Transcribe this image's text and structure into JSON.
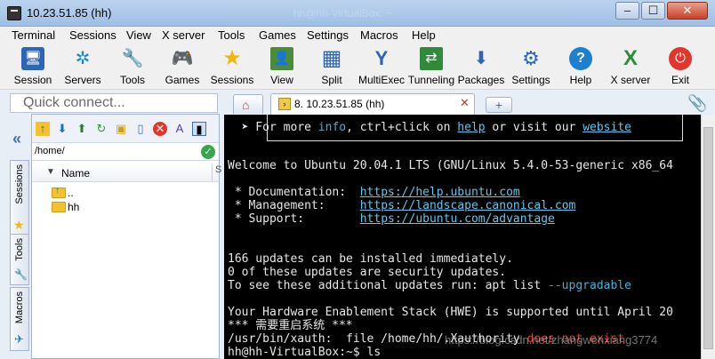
{
  "window": {
    "title": "10.23.51.85 (hh)",
    "ghost_title": "hh@hh-VirtualBox: ~",
    "min_label": "–",
    "max_label": "☐",
    "close_label": "✕"
  },
  "menu": [
    "Terminal",
    "Sessions",
    "View",
    "X server",
    "Tools",
    "Games",
    "Settings",
    "Macros",
    "Help"
  ],
  "toolbar": [
    {
      "label": "Session",
      "icon": "session-icon",
      "glyph": "🖥"
    },
    {
      "label": "Servers",
      "icon": "servers-icon",
      "glyph": "✲"
    },
    {
      "label": "Tools",
      "icon": "tools-icon",
      "glyph": "🔧"
    },
    {
      "label": "Games",
      "icon": "games-icon",
      "glyph": "🎮"
    },
    {
      "label": "Sessions",
      "icon": "star-icon",
      "glyph": "★"
    },
    {
      "label": "View",
      "icon": "view-icon",
      "glyph": "👤"
    },
    {
      "label": "Split",
      "icon": "split-icon",
      "glyph": "▦"
    },
    {
      "label": "MultiExec",
      "icon": "multiexec-icon",
      "glyph": "Y"
    },
    {
      "label": "Tunneling",
      "icon": "tunneling-icon",
      "glyph": "⇄"
    },
    {
      "label": "Packages",
      "icon": "packages-icon",
      "glyph": "⬇"
    },
    {
      "label": "Settings",
      "icon": "gear-icon",
      "glyph": "⚙"
    },
    {
      "label": "Help",
      "icon": "help-icon",
      "glyph": "?"
    },
    {
      "label": "X server",
      "icon": "xserver-icon",
      "glyph": "X"
    },
    {
      "label": "Exit",
      "icon": "power-icon",
      "glyph": "⏻"
    }
  ],
  "quick_connect": {
    "placeholder": "Quick connect..."
  },
  "tabs": {
    "session_tab_label": "8. 10.23.51.85 (hh)",
    "close_label": "✕",
    "new_tab_label": "+"
  },
  "side_tabs": [
    "Sessions",
    "Tools",
    "Macros"
  ],
  "sftp": {
    "path": "/home/",
    "column_name": "Name",
    "column_size_abbr": "S",
    "files": [
      {
        "name": ".."
      },
      {
        "name": "hh"
      }
    ]
  },
  "terminal": {
    "lines": [
      {
        "text": "  ➤ For more ",
        "parts": [
          {
            "t": "info",
            "c": "cy"
          },
          {
            "t": ", ctrl+click on ",
            "c": ""
          },
          {
            "t": "help",
            "c": "ul"
          },
          {
            "t": " or visit our ",
            "c": ""
          },
          {
            "t": "website",
            "c": "ul"
          }
        ]
      },
      {
        "text": ""
      },
      {
        "text": ""
      },
      {
        "text": "Welcome to Ubuntu 20.04.1 LTS (GNU/Linux 5.4.0-53-generic x86_64"
      },
      {
        "text": ""
      },
      {
        "text": " * Documentation:  ",
        "parts": [
          {
            "t": "https://help.ubuntu.com",
            "c": "ul"
          }
        ]
      },
      {
        "text": " * Management:     ",
        "parts": [
          {
            "t": "https://landscape.canonical.com",
            "c": "ul"
          }
        ]
      },
      {
        "text": " * Support:        ",
        "parts": [
          {
            "t": "https://ubuntu.com/advantage",
            "c": "ul"
          }
        ]
      },
      {
        "text": ""
      },
      {
        "text": ""
      },
      {
        "text": "166 updates can be installed immediately."
      },
      {
        "text": "0 of these updates are security updates."
      },
      {
        "text": "To see these additional updates run: apt list ",
        "parts": [
          {
            "t": "--upgradable",
            "c": "cy"
          }
        ]
      },
      {
        "text": ""
      },
      {
        "text": "Your Hardware Enablement Stack (HWE) is supported until April 20"
      },
      {
        "text": "*** 需要重启系统 ***"
      },
      {
        "text": "/usr/bin/xauth:  file /home/hh/.Xauthority ",
        "parts": [
          {
            "t": "does not exist",
            "c": "red"
          }
        ]
      },
      {
        "text": "hh@hh-VirtualBox:~$ ls"
      }
    ],
    "watermark": "https://blog.csdn.net/zhangwenxiang3774"
  }
}
